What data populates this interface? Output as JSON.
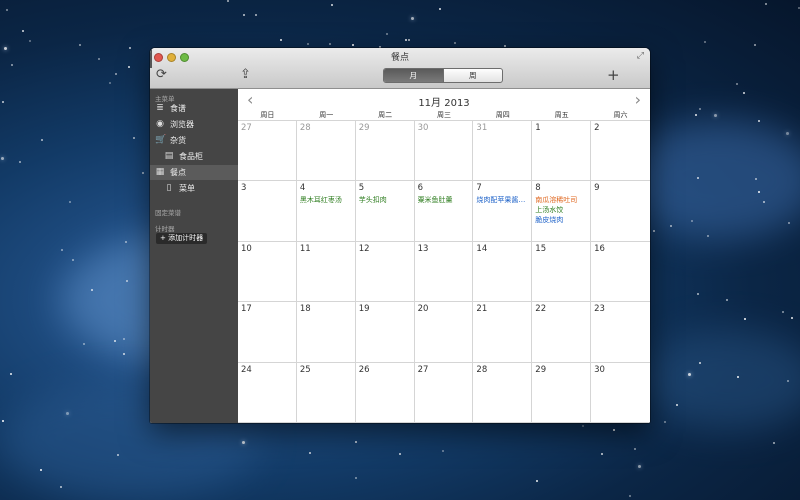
{
  "window": {
    "title": "餐点"
  },
  "toolbar": {
    "refresh_icon": "refresh-icon",
    "share_icon": "share-icon",
    "add_label": "+",
    "view_modes": [
      "月",
      "周"
    ],
    "active_view": "月"
  },
  "sidebar": {
    "sections": {
      "main_menu": "主菜单",
      "fixed_menu": "固定菜谱",
      "timers": "计时器"
    },
    "items": [
      {
        "icon": "≣",
        "label": "食谱",
        "sub": false,
        "selected": false
      },
      {
        "icon": "◉",
        "label": "浏览器",
        "sub": false,
        "selected": false
      },
      {
        "icon": "🛒",
        "label": "杂货",
        "sub": false,
        "selected": false
      },
      {
        "icon": "▤",
        "label": "食品柜",
        "sub": true,
        "selected": false
      },
      {
        "icon": "▦",
        "label": "餐点",
        "sub": false,
        "selected": true
      },
      {
        "icon": "▯",
        "label": "菜单",
        "sub": true,
        "selected": false
      }
    ],
    "add_timer_label": "+ 添加计时器"
  },
  "calendar": {
    "month_title": "11月 2013",
    "prev_arrow": "‹",
    "next_arrow": "›",
    "weekdays": [
      "周日",
      "周一",
      "周二",
      "周三",
      "周四",
      "周五",
      "周六"
    ],
    "days": [
      {
        "day": "27",
        "other": true,
        "events": []
      },
      {
        "day": "28",
        "other": true,
        "events": []
      },
      {
        "day": "29",
        "other": true,
        "events": []
      },
      {
        "day": "30",
        "other": true,
        "events": []
      },
      {
        "day": "31",
        "other": true,
        "events": []
      },
      {
        "day": "1",
        "other": false,
        "events": []
      },
      {
        "day": "2",
        "other": false,
        "events": []
      },
      {
        "day": "3",
        "other": false,
        "events": []
      },
      {
        "day": "4",
        "other": false,
        "events": [
          {
            "text": "黑木耳红枣汤",
            "color": "#2e7d1f"
          }
        ]
      },
      {
        "day": "5",
        "other": false,
        "events": [
          {
            "text": "芋头扣肉",
            "color": "#2e7d1f"
          }
        ]
      },
      {
        "day": "6",
        "other": false,
        "events": [
          {
            "text": "粟米鱼肚羹",
            "color": "#2e7d1f"
          }
        ]
      },
      {
        "day": "7",
        "other": false,
        "events": [
          {
            "text": "烧肉配苹果酱…",
            "color": "#1f63c9"
          }
        ]
      },
      {
        "day": "8",
        "other": false,
        "events": [
          {
            "text": "南瓜溶稀吐司",
            "color": "#e0671f"
          },
          {
            "text": "上汤水饺",
            "color": "#2e7d1f"
          },
          {
            "text": "脆皮烧肉",
            "color": "#1f63c9"
          }
        ]
      },
      {
        "day": "9",
        "other": false,
        "events": []
      },
      {
        "day": "10",
        "other": false,
        "events": []
      },
      {
        "day": "11",
        "other": false,
        "events": []
      },
      {
        "day": "12",
        "other": false,
        "events": []
      },
      {
        "day": "13",
        "other": false,
        "events": []
      },
      {
        "day": "14",
        "other": false,
        "events": []
      },
      {
        "day": "15",
        "other": false,
        "events": []
      },
      {
        "day": "16",
        "other": false,
        "events": []
      },
      {
        "day": "17",
        "other": false,
        "events": []
      },
      {
        "day": "18",
        "other": false,
        "events": []
      },
      {
        "day": "19",
        "other": false,
        "events": []
      },
      {
        "day": "20",
        "other": false,
        "events": []
      },
      {
        "day": "21",
        "other": false,
        "events": []
      },
      {
        "day": "22",
        "other": false,
        "events": []
      },
      {
        "day": "23",
        "other": false,
        "events": []
      },
      {
        "day": "24",
        "other": false,
        "events": []
      },
      {
        "day": "25",
        "other": false,
        "events": []
      },
      {
        "day": "26",
        "other": false,
        "events": []
      },
      {
        "day": "27",
        "other": false,
        "events": []
      },
      {
        "day": "28",
        "other": false,
        "events": []
      },
      {
        "day": "29",
        "other": false,
        "events": []
      },
      {
        "day": "30",
        "other": false,
        "events": []
      }
    ]
  }
}
